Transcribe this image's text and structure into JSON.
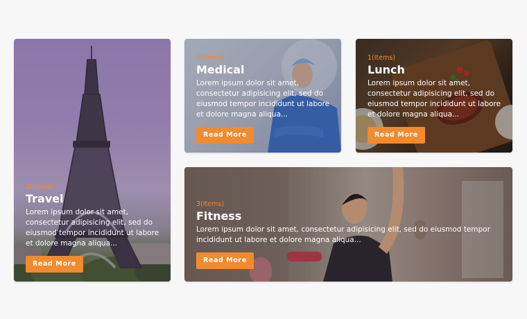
{
  "cards": [
    {
      "id": "travel",
      "count": "2(Items)",
      "title": "Travel",
      "description": "Lorem ipsum dolor sit amet, consectetur adipisicing elit, sed do eiusmod tempor incididunt ut labore et dolore magna aliqua...",
      "button": "Read More"
    },
    {
      "id": "medical",
      "count": "4(Items)",
      "title": "Medical",
      "description": "Lorem ipsum dolor sit amet, consectetur adipisicing elit, sed do eiusmod tempor incididunt ut labore et dolore magna aliqua...",
      "button": "Read More"
    },
    {
      "id": "lunch",
      "count": "1(Items)",
      "title": "Lunch",
      "description": "Lorem ipsum dolor sit amet, consectetur adipisicing elit, sed do eiusmod tempor incididunt ut labore et dolore magna aliqua...",
      "button": "Read More"
    },
    {
      "id": "fitness",
      "count": "3(Items)",
      "title": "Fitness",
      "description": "Lorem ipsum dolor sit amet, consectetur adipisicing elit, sed do eiusmod tempor incididunt ut labore et dolore magna aliqua...",
      "button": "Read More"
    }
  ],
  "colors": {
    "accent": "#f28a2e",
    "background": "#f7f7f8"
  }
}
